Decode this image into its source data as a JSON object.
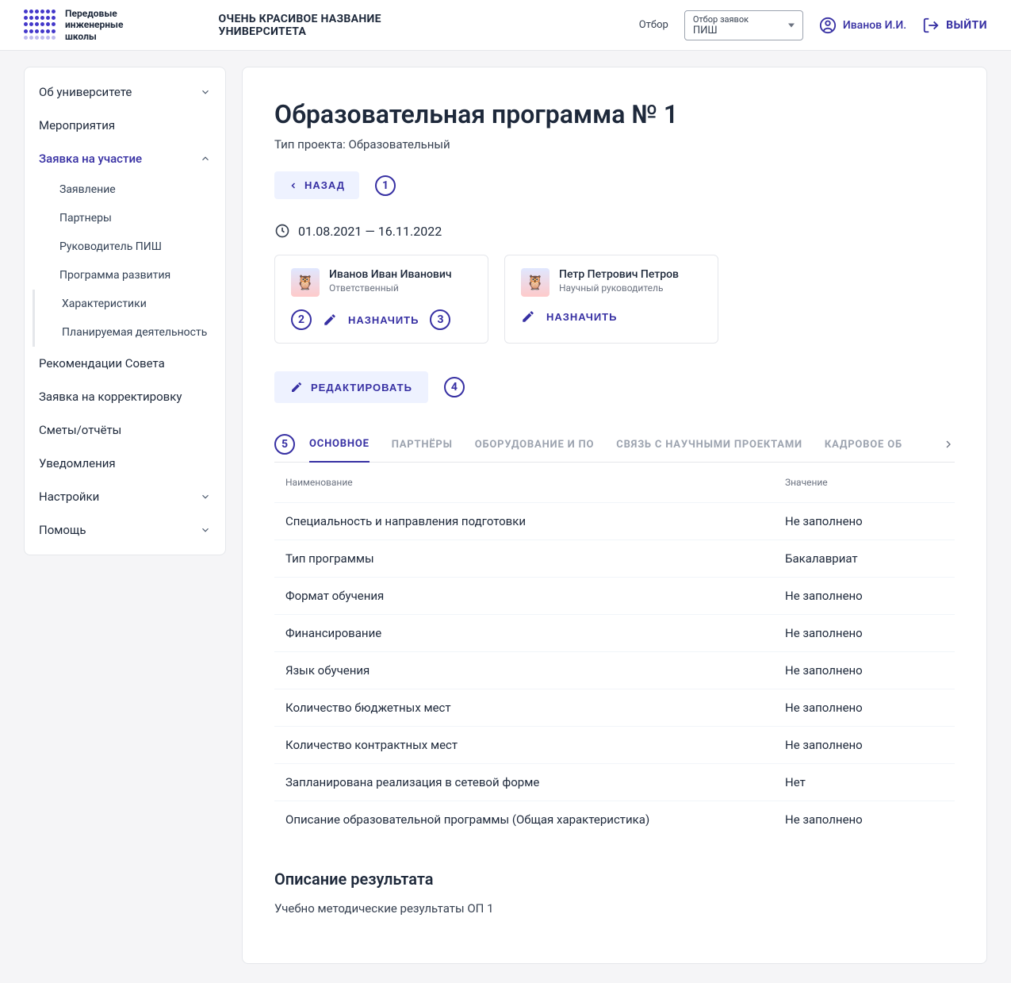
{
  "header": {
    "logo_text": "Передовые\nинженерные\nшколы",
    "university_name": "ОЧЕНЬ КРАСИВОЕ НАЗВАНИЕ УНИВЕРСИТЕТА",
    "selector_label": "Отбор",
    "selector_line1": "Отбор заявок",
    "selector_line2": "ПИШ",
    "user_name": "Иванов И.И.",
    "logout_label": "ВЫЙТИ"
  },
  "sidebar": {
    "items": [
      {
        "label": "Об университете",
        "expandable": true
      },
      {
        "label": "Мероприятия"
      },
      {
        "label": "Заявка на участие",
        "expandable": true,
        "expanded": true,
        "children": [
          {
            "label": "Заявление"
          },
          {
            "label": "Партнеры"
          },
          {
            "label": "Руководитель ПИШ"
          },
          {
            "label": "Программа развития"
          },
          {
            "label": "Характеристики",
            "indented": true
          },
          {
            "label": "Планируемая деятельность",
            "indented": true
          }
        ]
      },
      {
        "label": "Рекомендации Совета"
      },
      {
        "label": "Заявка на корректировку"
      },
      {
        "label": "Сметы/отчёты"
      },
      {
        "label": "Уведомления"
      },
      {
        "label": "Настройки",
        "expandable": true
      },
      {
        "label": "Помощь",
        "expandable": true
      }
    ]
  },
  "main": {
    "title": "Образовательная программа № 1",
    "subtitle": "Тип проекта: Образовательный",
    "back_label": "НАЗАД",
    "date_range": "01.08.2021 — 16.11.2022",
    "persons": [
      {
        "name": "Иванов Иван Иванович",
        "role": "Ответственный",
        "assign_label": "НАЗНАЧИТЬ",
        "annot_left": "2",
        "annot_right": "3"
      },
      {
        "name": "Петр Петрович Петров",
        "role": "Научный руководитель",
        "assign_label": "НАЗНАЧИТЬ"
      }
    ],
    "edit_label": "РЕДАКТИРОВАТЬ",
    "tabs": [
      {
        "label": "ОСНОВНОЕ",
        "active": true
      },
      {
        "label": "ПАРТНЁРЫ"
      },
      {
        "label": "ОБОРУДОВАНИЕ И ПО"
      },
      {
        "label": "СВЯЗЬ С НАУЧНЫМИ ПРОЕКТАМИ"
      },
      {
        "label": "КАДРОВОЕ ОБ"
      }
    ],
    "table": {
      "col_name": "Наименование",
      "col_value": "Значение",
      "rows": [
        {
          "name": "Специальность и направления подготовки",
          "value": "Не заполнено"
        },
        {
          "name": "Тип программы",
          "value": "Бакалавриат"
        },
        {
          "name": "Формат обучения",
          "value": "Не заполнено"
        },
        {
          "name": "Финансирование",
          "value": "Не заполнено"
        },
        {
          "name": "Язык обучения",
          "value": "Не заполнено"
        },
        {
          "name": "Количество бюджетных мест",
          "value": "Не заполнено"
        },
        {
          "name": "Количество контрактных мест",
          "value": "Не заполнено"
        },
        {
          "name": "Запланирована реализация в сетевой форме",
          "value": "Нет"
        },
        {
          "name": "Описание образовательной программы (Общая характеристика)",
          "value": "Не заполнено"
        }
      ]
    },
    "result_title": "Описание результата",
    "result_body": "Учебно методические результаты ОП 1"
  },
  "annotations": {
    "a1": "1",
    "a4": "4",
    "a5": "5"
  }
}
